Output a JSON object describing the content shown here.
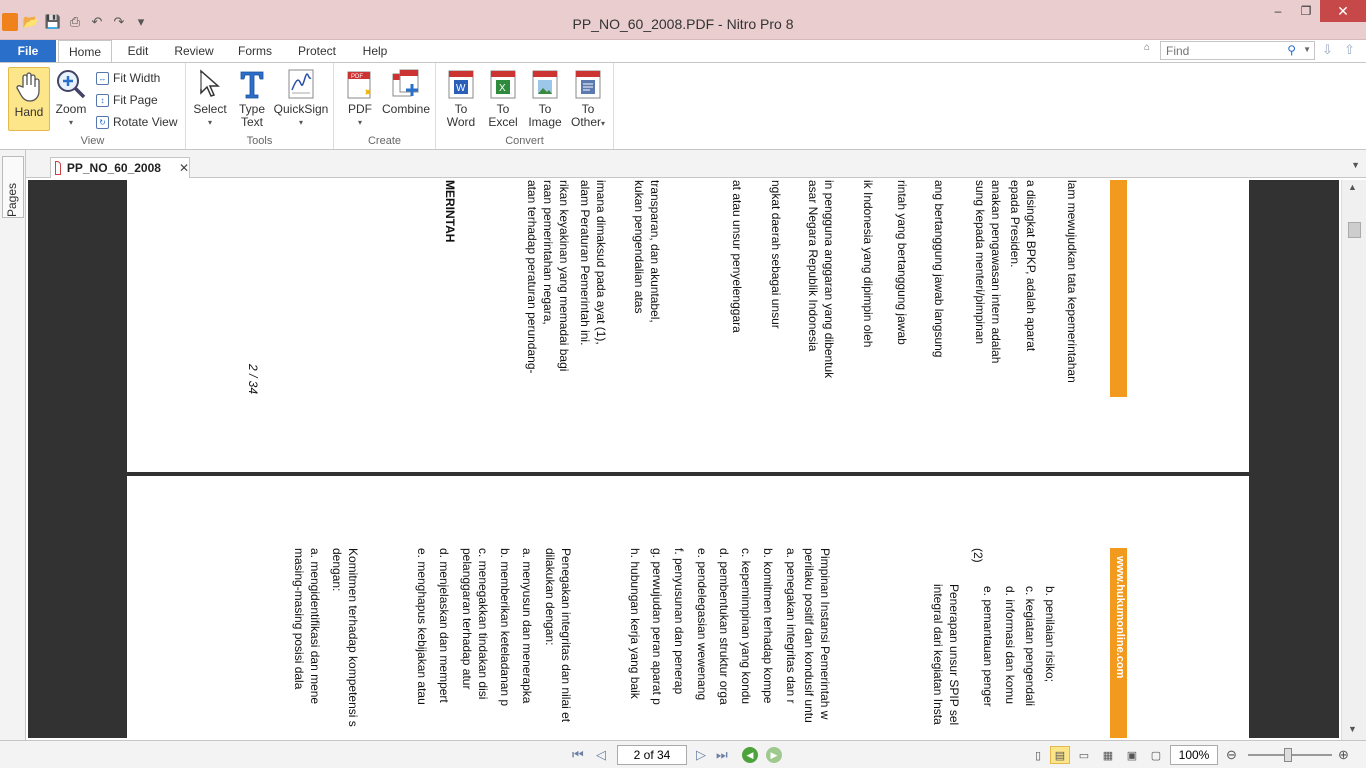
{
  "window": {
    "title": "PP_NO_60_2008.PDF - Nitro Pro 8",
    "minimize": "–",
    "maximize": "❐",
    "close": "✕"
  },
  "qat": {
    "open_icon": "📂",
    "save_icon": "💾",
    "print_icon": "⎙",
    "undo_icon": "↶",
    "redo_icon": "↷",
    "more_icon": "▾"
  },
  "ribbon_tabs": {
    "file": "File",
    "tabs": [
      {
        "label": "Home",
        "active": true
      },
      {
        "label": "Edit"
      },
      {
        "label": "Review"
      },
      {
        "label": "Forms"
      },
      {
        "label": "Protect"
      },
      {
        "label": "Help"
      }
    ],
    "find_placeholder": "Find"
  },
  "ribbon": {
    "view": {
      "label": "View",
      "hand": "Hand",
      "zoom": "Zoom",
      "fit_width": "Fit Width",
      "fit_page": "Fit Page",
      "rotate_view": "Rotate View"
    },
    "tools": {
      "label": "Tools",
      "select": "Select",
      "type_text_1": "Type",
      "type_text_2": "Text",
      "quicksign": "QuickSign"
    },
    "create": {
      "label": "Create",
      "pdf": "PDF",
      "combine": "Combine"
    },
    "convert": {
      "label": "Convert",
      "to_word_1": "To",
      "to_word_2": "Word",
      "to_excel_1": "To",
      "to_excel_2": "Excel",
      "to_image_1": "To",
      "to_image_2": "Image",
      "to_other_1": "To",
      "to_other_2": "Other"
    }
  },
  "side_panel": {
    "pages": "Pages"
  },
  "document_tab": {
    "name": "PP_NO_60_2008",
    "close": "✕"
  },
  "page1": {
    "lines": [
      "lam mewujudkan tata kepemerintahan",
      "a disingkat BPKP, adalah aparat",
      "epada Presiden.",
      "anakan pengawasan intern adalah",
      "sung kepada menteri/pimpinan",
      "ang bertanggung jawab langsung",
      "rintah yang bertanggung jawab",
      "ik Indonesia yang dipimpin oleh",
      "in pengguna anggaran yang dibentuk",
      "asar Negara Republik Indonesia",
      "ngkat daerah sebagai unsur",
      "at atau unsur penyelenggara",
      "transparan, dan akuntabel,",
      "kukan pengendalian atas",
      "imana dimaksud pada ayat (1),",
      "alam Peraturan Pemerintah ini.",
      "rikan keyakinan yang memadai bagi",
      "raan pemerintahan negara,",
      "atan terhadap peraturan perundang-",
      "MERINTAH"
    ],
    "page_number": "2 / 34"
  },
  "page2": {
    "watermark": "www.hukumonline.com",
    "lines": [
      "b.    penilaian risiko;",
      "c.    kegiatan pengendali",
      "d.    informasi dan komu",
      "e.    pemantauan penger",
      "(2)",
      "Penerapan unsur SPIP sel",
      "integral dari kegiatan Insta",
      "Pimpinan Instansi Pemerintah w",
      "perilaku positif dan kondusif untu",
      "a.    penegakan integritas dan r",
      "b.    komitmen terhadap kompe",
      "c.    kepemimpinan yang kondu",
      "d.    pembentukan struktur orga",
      "e.    pendelegasian wewenang",
      "f.    penyusunan dan penerap",
      "g.    perwujudan peran aparat p",
      "h.    hubungan kerja yang baik",
      "Penegakan integritas dan nilai et",
      "dilakukan dengan:",
      "a.    menyusun dan menerapka",
      "b.    memberikan keteladanan p",
      "c.    menegakkan tindakan disi",
      "       pelanggaran terhadap atur",
      "d.    menjelaskan dan mempert",
      "e.    menghapus kebijakan atau",
      "Komitmen terhadap kompetensi s",
      "dengan:",
      "a.    mengidentifikasi dan mene",
      "       masing-masing posisi dala"
    ]
  },
  "statusbar": {
    "page_value": "2 of 34",
    "zoom_value": "100%",
    "zoom_level_fraction": 0.48
  }
}
